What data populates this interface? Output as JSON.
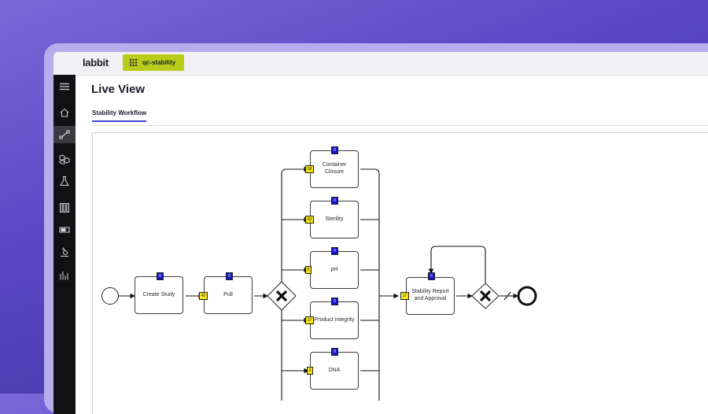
{
  "app": {
    "logo": "labbit",
    "workspace_chip": "qc-stability"
  },
  "sidebar": {
    "items": [
      {
        "icon": "menu-icon"
      },
      {
        "icon": "home-icon"
      },
      {
        "icon": "workflow-icon",
        "active": true
      },
      {
        "icon": "molecules-icon"
      },
      {
        "icon": "flask-icon"
      },
      {
        "icon": "test-tubes-icon"
      },
      {
        "icon": "instrument-icon"
      },
      {
        "icon": "microscope-icon"
      },
      {
        "icon": "bar-chart-icon"
      }
    ]
  },
  "page": {
    "title": "Live View",
    "tabs": [
      {
        "label": "Stability Workflow",
        "active": true
      }
    ]
  },
  "workflow": {
    "nodes": {
      "create_study": {
        "label": "Create Study",
        "top_count": "0"
      },
      "pull": {
        "label": "Pull",
        "top_count": "0",
        "left_count": "40"
      },
      "container_closure": {
        "label": "Container Closure",
        "top_count": "0",
        "left_count": "38"
      },
      "sterility": {
        "label": "Sterility",
        "top_count": "0",
        "left_count": "53"
      },
      "ph": {
        "label": "pH",
        "top_count": "0",
        "left_count": "5"
      },
      "product_integrity": {
        "label": "Product Integrity",
        "top_count": "0",
        "left_count": "17"
      },
      "dna": {
        "label": "DNA",
        "top_count": "0",
        "left_count": "3"
      },
      "stability_report": {
        "label": "Stability Report and Approval",
        "top_count": "5",
        "left_count": "17"
      }
    }
  },
  "colors": {
    "accent": "#3d49d8",
    "chip": "#b9cc1c",
    "badge_blue": "#1515c8",
    "badge_yellow": "#f4e418",
    "sidebar_bg": "#111114"
  }
}
